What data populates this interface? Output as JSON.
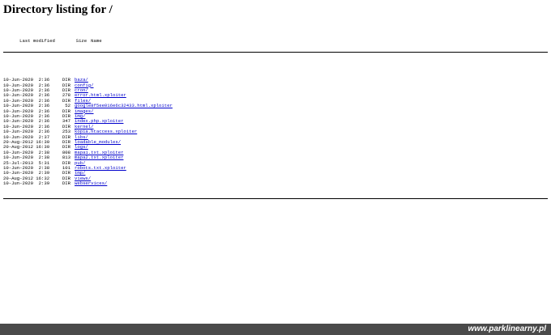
{
  "title": "Directory listing for /",
  "columns": {
    "modified": "Last modified",
    "size": "Size",
    "name": "Name"
  },
  "entries": [
    {
      "date": "10-Jun-2020  2:36",
      "size": "DIR",
      "name": "baza/"
    },
    {
      "date": "10-Jun-2020  2:36",
      "size": "DIR",
      "name": "config/"
    },
    {
      "date": "10-Jun-2020  2:36",
      "size": "DIR",
      "name": "cron/"
    },
    {
      "date": "10-Jun-2020  2:36",
      "size": "278",
      "name": "error.html.xploiter"
    },
    {
      "date": "10-Jun-2020  2:36",
      "size": "DIR",
      "name": "files/"
    },
    {
      "date": "10-Jun-2020  2:36",
      "size": "52",
      "name": "google8f5ee016e6c32433.html.xploiter"
    },
    {
      "date": "10-Jun-2020  2:36",
      "size": "DIR",
      "name": "images/"
    },
    {
      "date": "10-Jun-2020  2:36",
      "size": "DIR",
      "name": "img/"
    },
    {
      "date": "10-Jun-2020  2:36",
      "size": "347",
      "name": "index.php.xploiter"
    },
    {
      "date": "10-Jun-2020  2:36",
      "size": "DIR",
      "name": "kernel/"
    },
    {
      "date": "10-Jun-2020  2:36",
      "size": "253",
      "name": "kopia.htaccess.xploiter"
    },
    {
      "date": "10-Jun-2020  2:37",
      "size": "DIR",
      "name": "libs/"
    },
    {
      "date": "20-Aug-2012 16:30",
      "size": "DIR",
      "name": "loadable_modules/"
    },
    {
      "date": "20-Aug-2012 16:30",
      "size": "DIR",
      "name": "logs/"
    },
    {
      "date": "10-Jun-2020  2:38",
      "size": "808",
      "name": "mapa1.txt.xploiter"
    },
    {
      "date": "10-Jun-2020  2:38",
      "size": "813",
      "name": "mapa2.txt.xploiter"
    },
    {
      "date": "25-Jul-2013  5:31",
      "size": "DIR",
      "name": "pub/"
    },
    {
      "date": "10-Jun-2020  2:38",
      "size": "101",
      "name": "robots.txt.xploiter"
    },
    {
      "date": "10-Jun-2020  2:39",
      "size": "DIR",
      "name": "tmp/"
    },
    {
      "date": "20-Aug-2012 16:32",
      "size": "DIR",
      "name": "views/"
    },
    {
      "date": "10-Jun-2020  2:39",
      "size": "DIR",
      "name": "webservices/"
    }
  ],
  "footer": {
    "brand": "www.parklinearny.pl"
  },
  "colors": {
    "link": "#0000cc",
    "footer_bg": "#4a4a4a"
  }
}
